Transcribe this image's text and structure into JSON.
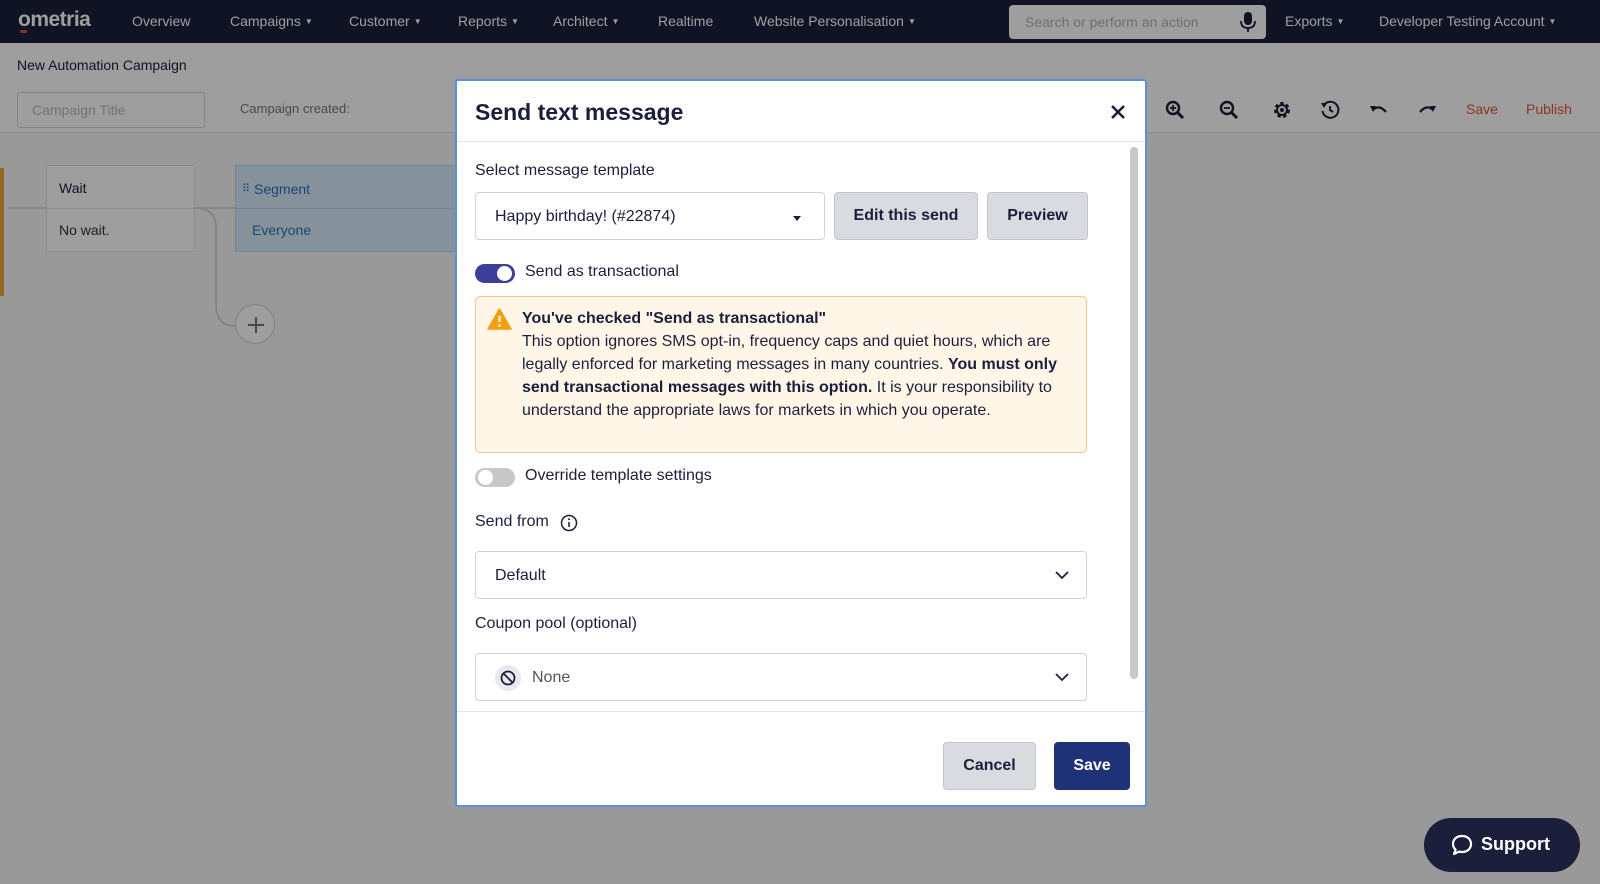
{
  "nav": {
    "logo": "ometria",
    "items": {
      "overview": "Overview",
      "campaigns": "Campaigns",
      "customer": "Customer",
      "reports": "Reports",
      "architect": "Architect",
      "realtime": "Realtime",
      "website_personalisation": "Website Personalisation",
      "exports": "Exports",
      "account": "Developer Testing Account"
    },
    "search_placeholder": "Search or perform an action"
  },
  "subheader": {
    "title": "New Automation Campaign",
    "campaign_title_placeholder": "Campaign Title",
    "campaign_created": "Campaign created:",
    "save": "Save",
    "publish": "Publish"
  },
  "canvas": {
    "wait_node": {
      "title": "Wait",
      "body": "No wait."
    },
    "segment_node": {
      "title": "Segment",
      "body": "Everyone"
    }
  },
  "modal": {
    "title": "Send text message",
    "template_label": "Select message template",
    "template_value": "Happy birthday! (#22874)",
    "edit_button": "Edit this send",
    "preview_button": "Preview",
    "transactional": {
      "label": "Send as transactional",
      "enabled": true
    },
    "warning": {
      "title": "You've checked \"Send as transactional\"",
      "text1": "This option ignores SMS opt-in, frequency caps and quiet hours, which are legally enforced for marketing messages in many countries. ",
      "bold": "You must only send transactional messages with this option.",
      "text2": " It is your responsibility to understand the appropriate laws for markets in which you operate."
    },
    "override": {
      "label": "Override template settings",
      "enabled": false
    },
    "send_from": {
      "label": "Send from",
      "value": "Default"
    },
    "coupon_pool": {
      "label": "Coupon pool (optional)",
      "value": "None"
    },
    "cancel_button": "Cancel",
    "save_button": "Save"
  },
  "support": {
    "label": "Support"
  },
  "colors": {
    "nav_bg": "#1b1f3b",
    "accent_red": "#e8503a",
    "toggle_on": "#3a3f9a",
    "primary_button": "#1e3278",
    "warning_bg": "#fff6e8",
    "warning_border": "#f1c57c",
    "warning_icon": "#f59e0b"
  }
}
